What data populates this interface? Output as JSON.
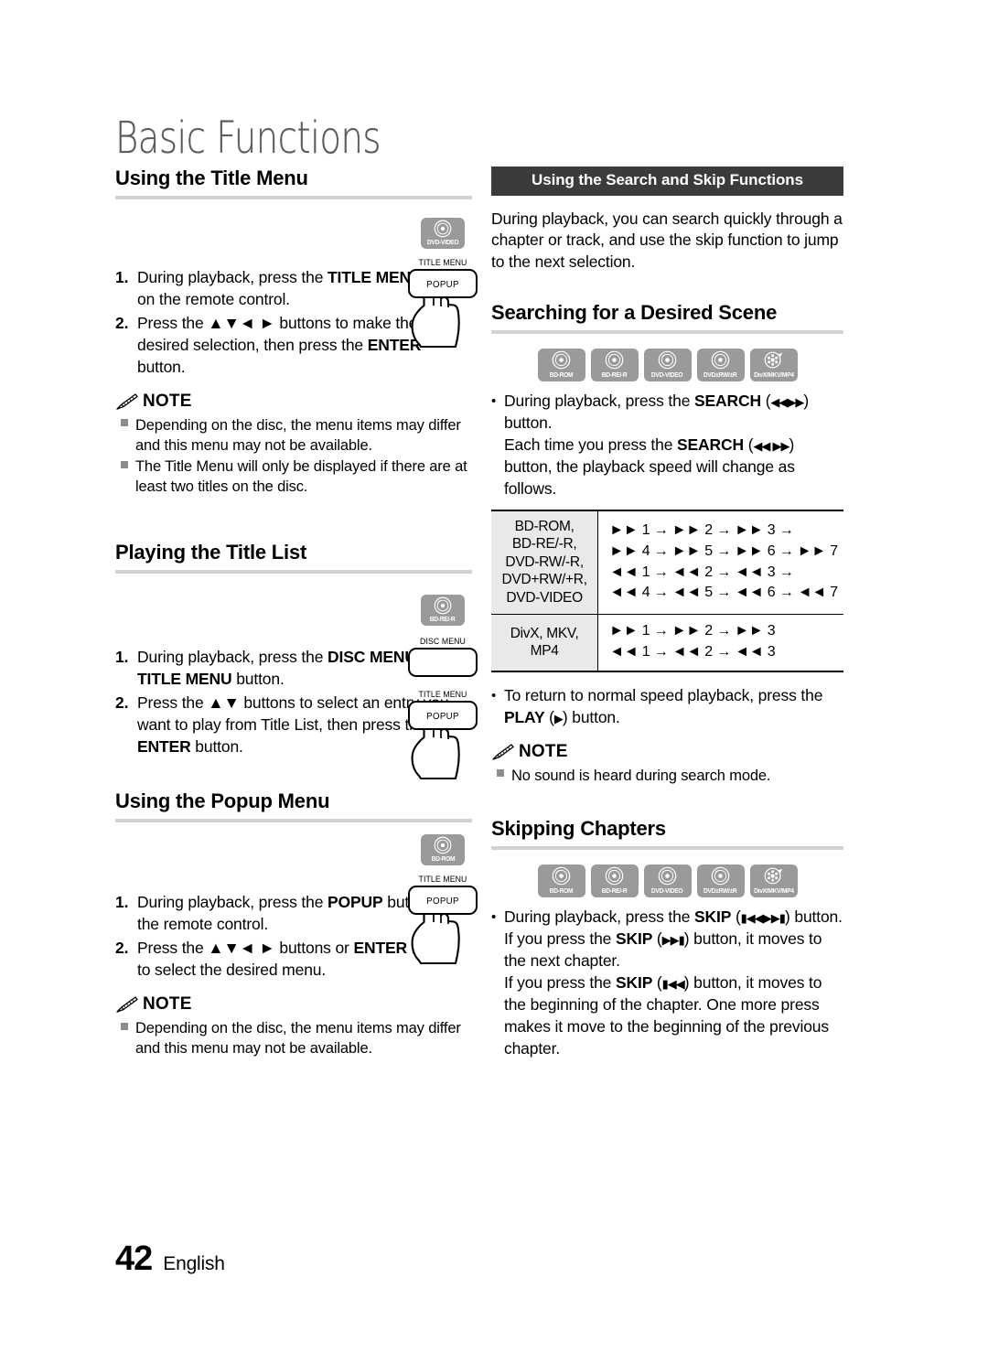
{
  "page": {
    "chapter_title": "Basic Functions",
    "page_number": "42",
    "language": "English"
  },
  "colors": {
    "bar_heading_bg": "#3b3b3b",
    "heading_rule": "#d2d2d2",
    "badge_bg": "#9a9a9a",
    "table_label_bg": "#e9e9e9",
    "note_square": "#8d8d8d",
    "chapter_title": "#5a5a5a"
  },
  "left_column": {
    "title_menu": {
      "heading": "Using the Title Menu",
      "steps": [
        {
          "num": "1.",
          "html": "During playback, press the <b>TITLE MENU</b> button on the remote control."
        },
        {
          "num": "2.",
          "html": "Press the ▲▼◄ ► buttons to make the desired selection, then press the <b>ENTER</b> button."
        }
      ],
      "note_label": "NOTE",
      "notes": [
        "Depending on the disc, the menu items may differ and this menu may not be available.",
        "The Title Menu will only be displayed if there are at least two titles on the disc."
      ],
      "disc_badge": "DVD-VIDEO",
      "remote_buttons": [
        {
          "label": "TITLE MENU",
          "text": "POPUP"
        }
      ]
    },
    "title_list": {
      "heading": "Playing the Title List",
      "steps": [
        {
          "num": "1.",
          "html": "During playback, press the <b>DISC MENU</b> or <b>TITLE MENU</b> button."
        },
        {
          "num": "2.",
          "html": "Press the ▲▼ buttons to select an entry you want to play from Title List, then press the <b>ENTER</b> button."
        }
      ],
      "disc_badge": "BD-RE/-R",
      "remote_buttons": [
        {
          "label": "DISC MENU",
          "text": ""
        },
        {
          "label": "TITLE MENU",
          "text": "POPUP"
        }
      ]
    },
    "popup_menu": {
      "heading": "Using the Popup Menu",
      "steps": [
        {
          "num": "1.",
          "html": "During playback, press the <b>POPUP</b> button on the remote control."
        },
        {
          "num": "2.",
          "html": "Press the ▲▼◄ ► buttons or <b>ENTER</b> button to select the desired menu."
        }
      ],
      "note_label": "NOTE",
      "notes": [
        "Depending on the disc, the menu items may differ and this menu may not be available."
      ],
      "disc_badge": "BD-ROM",
      "remote_buttons": [
        {
          "label": "TITLE MENU",
          "text": "POPUP"
        }
      ]
    }
  },
  "right_column": {
    "bar_heading": "Using the Search and Skip Functions",
    "intro": "During playback, you can search quickly through a chapter or track, and use the skip function to jump to the next selection.",
    "searching": {
      "heading": "Searching for a Desired Scene",
      "badges": [
        "BD-ROM",
        "BD-RE/-R",
        "DVD-VIDEO",
        "DVD±RW/±R",
        "DivX/MKV/MP4"
      ],
      "bullets": [
        "During playback, press the SEARCH (◄◄ ►►) button.",
        "Each time you press the SEARCH (◄◄ ►►) button, the playback speed will change as follows."
      ],
      "table": {
        "rows": [
          {
            "label": "BD-ROM,\nBD-RE/-R,\nDVD-RW/-R,\nDVD+RW/+R,\nDVD-VIDEO",
            "label_lines": [
              "BD-ROM,",
              "BD-RE/-R,",
              "DVD-RW/-R,",
              "DVD+RW/+R,",
              "DVD-VIDEO"
            ],
            "value_lines": [
              "►► 1 → ►► 2 → ►► 3 →",
              "►► 4 → ►► 5 → ►► 6 → ►► 7",
              "◄◄ 1 → ◄◄ 2 → ◄◄ 3 →",
              "◄◄ 4 → ◄◄ 5 → ◄◄ 6 → ◄◄ 7"
            ]
          },
          {
            "label": "DivX, MKV, MP4",
            "label_lines": [
              "DivX, MKV, MP4"
            ],
            "value_lines": [
              "►► 1 → ►► 2 → ►► 3",
              "◄◄ 1 → ◄◄ 2 → ◄◄ 3"
            ]
          }
        ]
      },
      "after_table_bullet": "To return to normal speed playback, press the PLAY (►) button.",
      "note_label": "NOTE",
      "notes": [
        "No sound is heard during search mode."
      ]
    },
    "skipping": {
      "heading": "Skipping Chapters",
      "badges": [
        "BD-ROM",
        "BD-RE/-R",
        "DVD-VIDEO",
        "DVD±RW/±R",
        "DivX/MKV/MP4"
      ],
      "bullet": "During playback, press the SKIP (|◄◄ ►►|) button. If you press the SKIP (►►|) button, it moves to the next chapter. If you press the SKIP (|◄◄) button, it moves to the beginning of the chapter. One more press makes it move to the beginning of the previous chapter."
    }
  }
}
